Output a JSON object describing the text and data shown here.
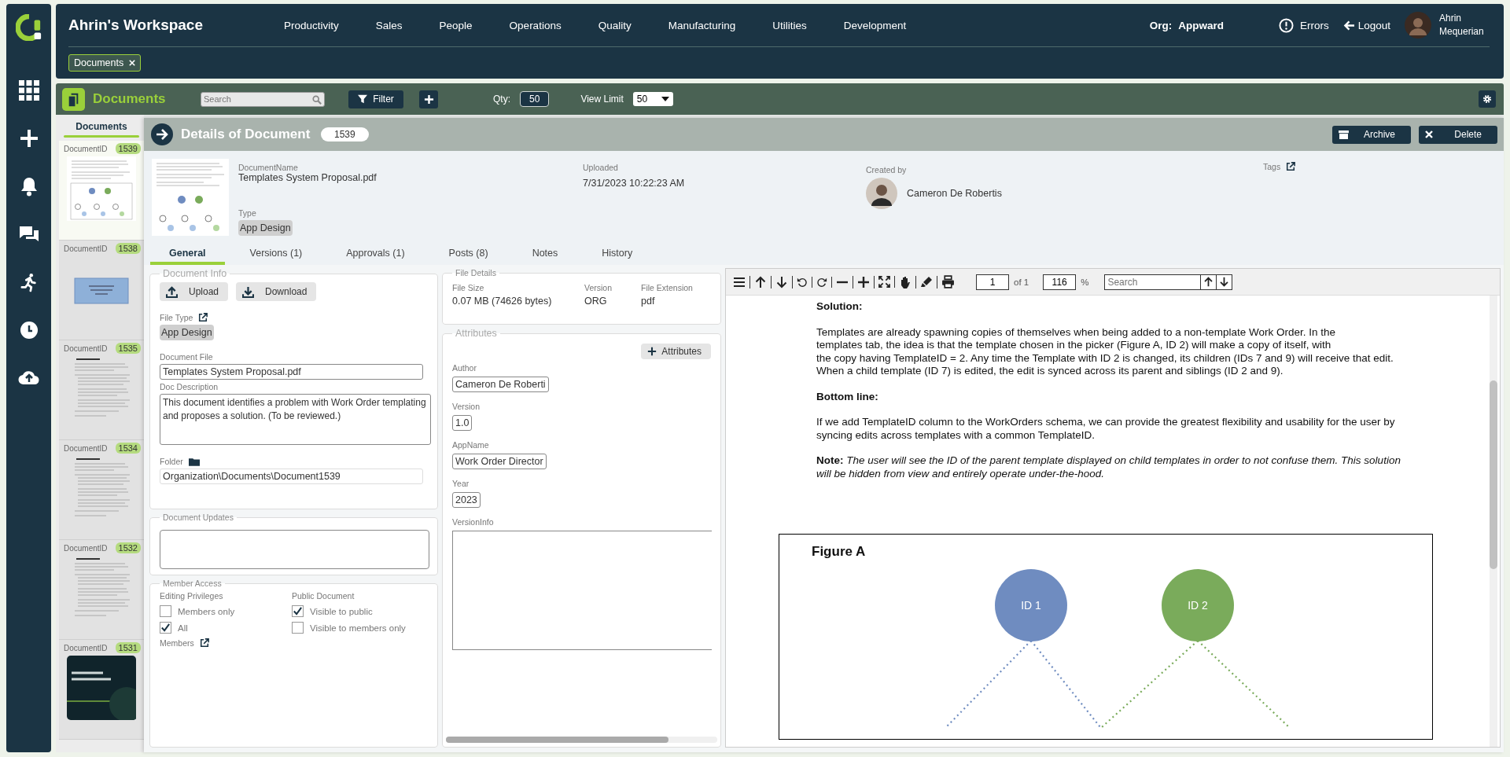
{
  "header": {
    "title": "Ahrin's Workspace",
    "nav": [
      "Productivity",
      "Sales",
      "People",
      "Operations",
      "Quality",
      "Manufacturing",
      "Utilities",
      "Development"
    ],
    "org_label": "Org:",
    "org": "Appward",
    "errors": "Errors",
    "logout": "Logout",
    "user": "Ahrin Mequerian"
  },
  "open_tabs": [
    {
      "label": "Documents",
      "selected": true
    }
  ],
  "toolbar": {
    "title": "Documents",
    "search_placeholder": "Search",
    "filter": "Filter",
    "qty_label": "Qty:",
    "qty": "50",
    "view_limit_label": "View Limit",
    "view_limit": "50"
  },
  "list": {
    "title": "Documents",
    "items": [
      {
        "label": "DocumentID",
        "id": "1539",
        "selected": true,
        "kind": "diagram"
      },
      {
        "label": "DocumentID",
        "id": "1538",
        "selected": false,
        "kind": "card"
      },
      {
        "label": "DocumentID",
        "id": "1535",
        "selected": false,
        "kind": "text"
      },
      {
        "label": "DocumentID",
        "id": "1534",
        "selected": false,
        "kind": "text"
      },
      {
        "label": "DocumentID",
        "id": "1532",
        "selected": false,
        "kind": "text"
      },
      {
        "label": "DocumentID",
        "id": "1531",
        "selected": false,
        "kind": "slide"
      }
    ]
  },
  "details": {
    "title": "Details of Document",
    "id": "1539",
    "archive": "Archive",
    "delete": "Delete",
    "name_label": "DocumentName",
    "name": "Templates System Proposal.pdf",
    "type_label": "Type",
    "type": "App Design",
    "uploaded_label": "Uploaded",
    "uploaded": "7/31/2023 10:22:23 AM",
    "created_by_label": "Created by",
    "created_by": "Cameron De Robertis",
    "tags_label": "Tags"
  },
  "tabs": [
    {
      "label": "General",
      "selected": true
    },
    {
      "label": "Versions (1)",
      "selected": false
    },
    {
      "label": "Approvals (1)",
      "selected": false
    },
    {
      "label": "Posts (8)",
      "selected": false
    },
    {
      "label": "Notes",
      "selected": false
    },
    {
      "label": "History",
      "selected": false
    }
  ],
  "document_info": {
    "legend": "Document Info",
    "upload": "Upload",
    "download": "Download",
    "file_type_label": "File Type",
    "file_type": "App Design",
    "file_label": "Document File",
    "file": "Templates System Proposal.pdf",
    "description_label": "Doc Description",
    "description": "This document identifies a problem with Work Order templating and proposes a solution. (To be reviewed.)",
    "folder_label": "Folder",
    "folder": "Organization\\Documents\\Document1539"
  },
  "document_updates": {
    "legend": "Document Updates"
  },
  "member_access": {
    "legend": "Member Access",
    "editing_label": "Editing Privileges",
    "editing": [
      {
        "label": "Members only",
        "checked": false
      },
      {
        "label": "All",
        "checked": true
      }
    ],
    "public_label": "Public Document",
    "public": [
      {
        "label": "Visible to public",
        "checked": true
      },
      {
        "label": "Visible to members only",
        "checked": false
      }
    ],
    "members_label": "Members"
  },
  "file_details": {
    "legend": "File Details",
    "fields": [
      {
        "label": "File Size",
        "value": "0.07 MB (74626 bytes)"
      },
      {
        "label": "Version",
        "value": "ORG"
      },
      {
        "label": "File Extension",
        "value": "pdf"
      }
    ]
  },
  "attributes": {
    "legend": "Attributes",
    "add": "Attributes",
    "fields": [
      {
        "label": "Author",
        "value": "Cameron De Roberti"
      },
      {
        "label": "Version",
        "value": "1.0"
      },
      {
        "label": "AppName",
        "value": "Work Order Director"
      },
      {
        "label": "Year",
        "value": "2023"
      }
    ],
    "version_info_label": "VersionInfo"
  },
  "viewer": {
    "page": "1",
    "of": "of 1",
    "zoom": "116",
    "percent": "%",
    "search_placeholder": "Search",
    "content": [
      {
        "kind": "heading",
        "text": "Solution:"
      },
      {
        "kind": "paragraph",
        "text": "Templates are already spawning copies of themselves when being added to a non-template Work Order. In the\ntemplates tab, the idea is that the template chosen in the picker (Figure A, ID 2) will make a copy of itself, with\nthe copy having TemplateID = 2. Any time the Template with ID 2 is changed, its children (IDs 7 and 9) will receive that edit.\nWhen a child template (ID 7) is edited, the edit is synced across its parent and siblings (ID 2 and 9)."
      },
      {
        "kind": "heading",
        "text": "Bottom line:"
      },
      {
        "kind": "paragraph",
        "text": "If we add TemplateID column to the WorkOrders schema, we can provide the greatest flexibility and usability for the user by\nsyncing edits across templates with a common TemplateID."
      },
      {
        "kind": "paragraph",
        "text": "**Note:** *The user will see the ID of the parent template displayed on child templates in order to not confuse them. This solution\nwill be hidden from view and entirely operate under-the-hood.*"
      }
    ],
    "figure": {
      "title": "Figure A",
      "nodes": [
        {
          "label": "ID 1",
          "color": "#6f8cc0"
        },
        {
          "label": "ID 2",
          "color": "#7aab5b"
        }
      ]
    }
  }
}
